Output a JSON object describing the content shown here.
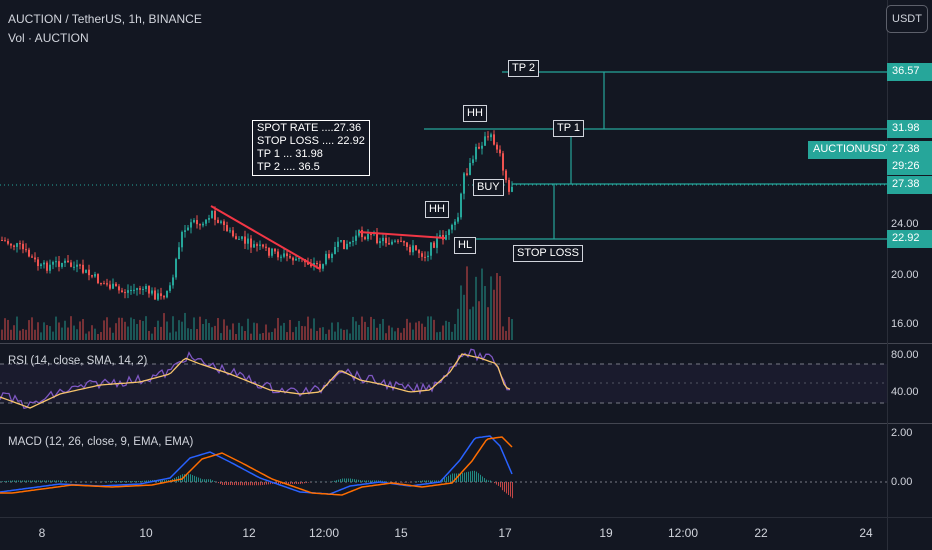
{
  "header": {
    "symbol": "AUCTION / TetherUS, 1h, BINANCE",
    "volume_label": "Vol · AUCTION",
    "currency_button": "USDT"
  },
  "annotations": {
    "info_box": [
      "SPOT RATE ....27.36",
      "STOP LOSS .... 22.92",
      "TP 1 ... 31.98",
      "TP 2 .... 36.5"
    ],
    "hh_1": "HH",
    "hh_2": "HH",
    "hl": "HL",
    "buy": "BUY",
    "tp1": "TP 1",
    "tp2": "TP 2",
    "stop_loss": "STOP LOSS"
  },
  "price_axis": {
    "ticks": [
      "24.00",
      "20.00",
      "16.00"
    ],
    "tags": {
      "tp2": "36.57",
      "tp1": "31.98",
      "symbol": "AUCTIONUSDT",
      "last_price": "27.38",
      "countdown": "29:26",
      "entry": "27.38",
      "stop": "22.92"
    }
  },
  "rsi": {
    "label": "RSI (14, close, SMA, 14, 2)",
    "ticks": [
      "80.00",
      "40.00"
    ]
  },
  "macd": {
    "label": "MACD (12, 26, close, 9, EMA, EMA)",
    "ticks": [
      "2.00",
      "0.00"
    ]
  },
  "time_axis": [
    "8",
    "10",
    "12",
    "12:00",
    "15",
    "17",
    "19",
    "12:00",
    "22",
    "24"
  ],
  "colors": {
    "background": "#131722",
    "up": "#26a69a",
    "down": "#ef5350",
    "level_line": "#26a69a",
    "trend_line": "#f23645",
    "rsi_line": "#7e57c2",
    "macd_line": "#2962ff",
    "signal_line": "#ff6d00"
  }
}
